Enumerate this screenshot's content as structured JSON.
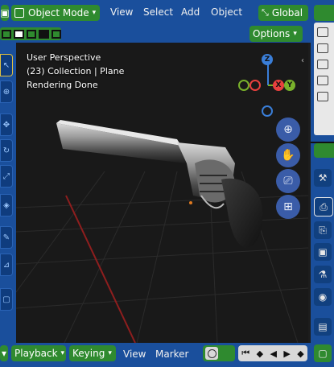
{
  "header": {
    "mode_label": "Object Mode",
    "menus": [
      "View",
      "Select",
      "Add",
      "Object"
    ],
    "orientation_label": "Global",
    "options_label": "Options"
  },
  "viewport": {
    "view_name": "User Perspective",
    "collection_info": "(23) Collection | Plane",
    "status": "Rendering Done"
  },
  "gizmo": {
    "z": "Z",
    "x": "X",
    "y": "Y"
  },
  "navigation_icons": [
    "zoom-icon",
    "pan-hand-icon",
    "camera-view-icon",
    "grid-ortho-icon"
  ],
  "timeline": {
    "playback_label": "Playback",
    "keying_label": "Keying",
    "view_label": "View",
    "marker_label": "Marker"
  },
  "colors": {
    "header_blue": "#1a4f9c",
    "accent_green": "#2f8a2f",
    "viewport_bg": "#191919",
    "axis_x": "#e8403e",
    "axis_y": "#79b12b",
    "axis_z": "#3a7ed8"
  }
}
